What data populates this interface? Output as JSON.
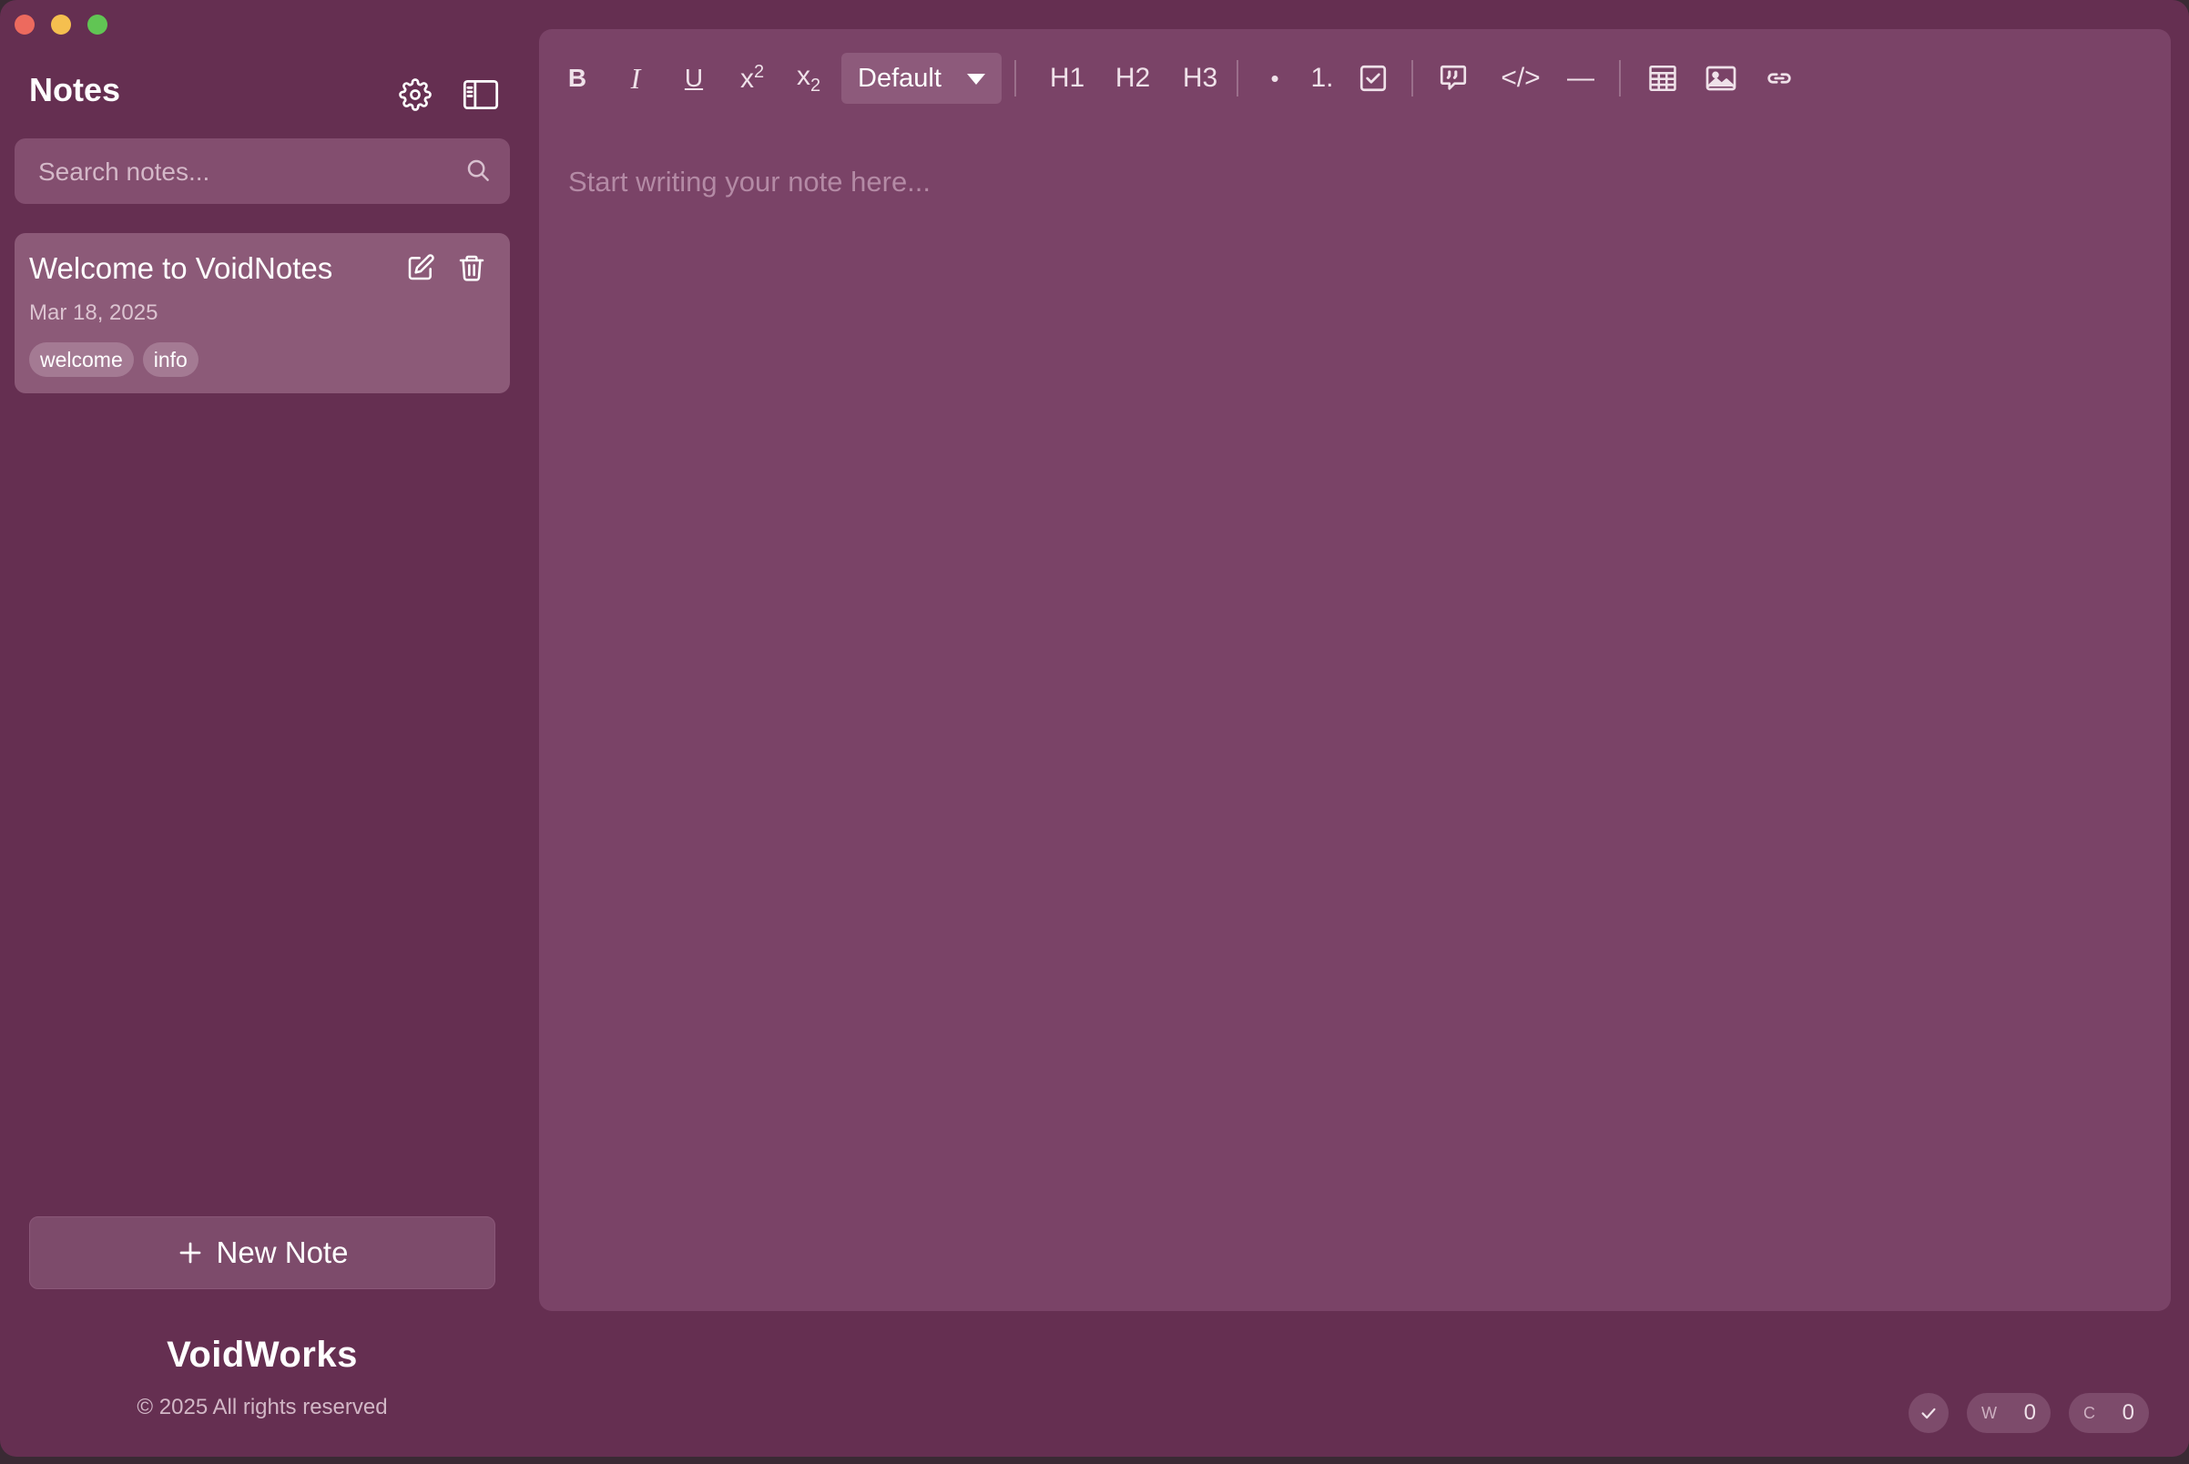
{
  "sidebar": {
    "title": "Notes",
    "search_placeholder": "Search notes...",
    "new_note_label": "New Note",
    "brand": "VoidWorks",
    "copyright": "© 2025 All rights reserved"
  },
  "notes": [
    {
      "title": "Welcome to VoidNotes",
      "date": "Mar 18, 2025",
      "tags": [
        "welcome",
        "info"
      ]
    }
  ],
  "toolbar": {
    "bold": "B",
    "italic": "I",
    "underline": "U",
    "font_select": "Default",
    "h1": "H1",
    "h2": "H2",
    "h3": "H3",
    "bullet": "•",
    "ordered": "1.",
    "code": "</>",
    "rule": "—"
  },
  "editor": {
    "placeholder": "Start writing your note here..."
  },
  "status": {
    "words_label": "W",
    "words_value": "0",
    "chars_label": "C",
    "chars_value": "0"
  },
  "colors": {
    "window_bg": "#652f51",
    "editor_bg": "#7a4367",
    "card_bg": "#8c5a78",
    "accent_text": "#ffffff"
  }
}
